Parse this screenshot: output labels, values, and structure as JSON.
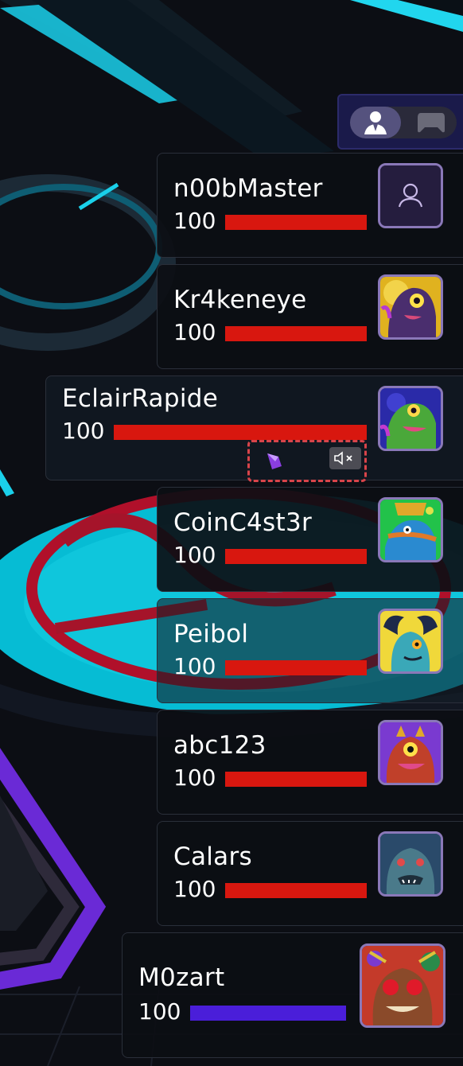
{
  "view_toggle": {
    "active": "player-view",
    "icons": [
      "player-view-icon",
      "controller-icon"
    ]
  },
  "players": [
    {
      "name": "n00bMaster",
      "hp": "100",
      "health_fraction": 1.0,
      "avatar": "default-person-icon",
      "bar_color": "#d8170f"
    },
    {
      "name": "Kr4keneye",
      "hp": "100",
      "health_fraction": 1.0,
      "avatar": "purple-dragon-portrait",
      "bar_color": "#d8170f"
    },
    {
      "name": "EclairRapide",
      "hp": "100",
      "health_fraction": 1.0,
      "avatar": "green-lizard-portrait",
      "bar_color": "#d8170f",
      "selected": true,
      "status": {
        "gem": "purple-gem-icon",
        "mute": "muted-speaker-icon"
      }
    },
    {
      "name": "CoinC4st3r",
      "hp": "100",
      "health_fraction": 1.0,
      "avatar": "fish-wizard-portrait",
      "bar_color": "#d8170f"
    },
    {
      "name": "Peibol",
      "hp": "100",
      "health_fraction": 1.0,
      "avatar": "horned-blue-portrait",
      "bar_color": "#d8170f"
    },
    {
      "name": "abc123",
      "hp": "100",
      "health_fraction": 1.0,
      "avatar": "red-beast-portrait",
      "bar_color": "#d8170f"
    },
    {
      "name": "Calars",
      "hp": "100",
      "health_fraction": 1.0,
      "avatar": "stone-monkey-portrait",
      "bar_color": "#d8170f"
    },
    {
      "name": "M0zart",
      "hp": "100",
      "health_fraction": 1.0,
      "avatar": "red-panda-portrait",
      "bar_color": "#4a1ed9",
      "is_self": true
    }
  ]
}
